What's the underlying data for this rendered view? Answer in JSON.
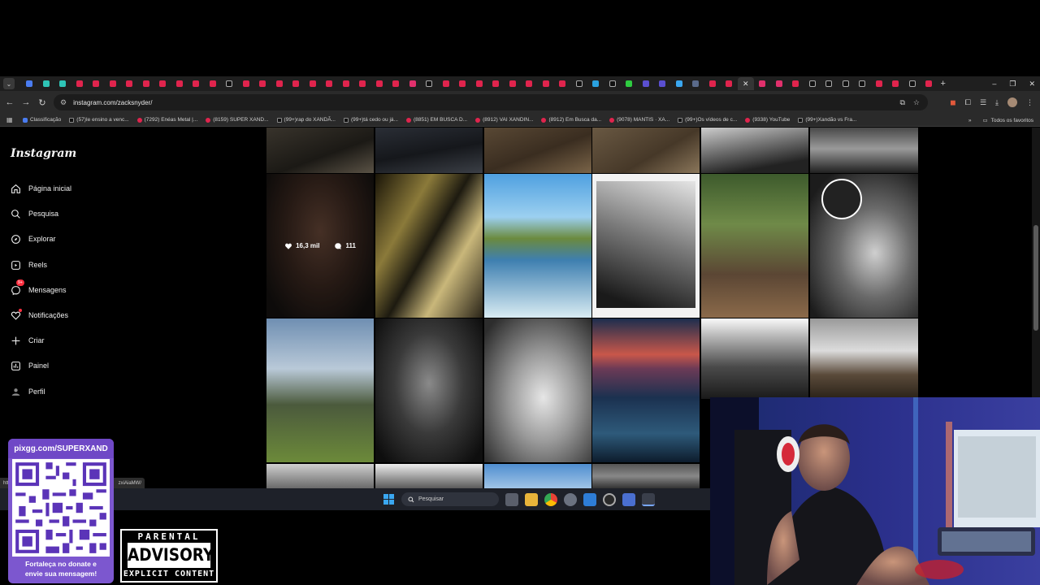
{
  "browser": {
    "tab_count": 55,
    "new_tab_label": "+",
    "window_controls": [
      "–",
      "❐",
      "✕"
    ],
    "address": {
      "url": "instagram.com/zacksnyder/"
    },
    "bookmarks": [
      {
        "label": "Classificação",
        "icon": "trophy-icon"
      },
      {
        "label": "(57)Ie ensino a venc...",
        "icon": "tiktok-icon"
      },
      {
        "label": "(7292) Enéas Metal |...",
        "icon": "youtube-icon"
      },
      {
        "label": "(8159) SUPER XAND...",
        "icon": "youtube-icon"
      },
      {
        "label": "(99+)rap do XANDÃ...",
        "icon": "tiktok-icon"
      },
      {
        "label": "(99+)tá cedo ou já...",
        "icon": "tiktok-icon"
      },
      {
        "label": "(8851) EM BUSCA D...",
        "icon": "youtube-icon"
      },
      {
        "label": "(8912) VAI XANDIN...",
        "icon": "youtube-icon"
      },
      {
        "label": "(8912) Em Busca da...",
        "icon": "youtube-icon"
      },
      {
        "label": "(9078) MANTIS · XA...",
        "icon": "youtube-icon"
      },
      {
        "label": "(99+)Os vídeos de c...",
        "icon": "tiktok-icon"
      },
      {
        "label": "(9338) YouTube",
        "icon": "youtube-icon"
      },
      {
        "label": "(99+)Xandão vs Fra...",
        "icon": "tiktok-icon"
      }
    ],
    "more_bookmarks": "»",
    "all_bookmarks": "Todos os favoritos",
    "status_url": {
      "left": "htt",
      "right": "zxiAiaMW/"
    }
  },
  "instagram": {
    "logo": "Instagram",
    "nav": [
      {
        "label": "Página inicial",
        "icon": "home-icon"
      },
      {
        "label": "Pesquisa",
        "icon": "search-icon"
      },
      {
        "label": "Explorar",
        "icon": "compass-icon"
      },
      {
        "label": "Reels",
        "icon": "reels-icon"
      },
      {
        "label": "Mensagens",
        "icon": "messenger-icon",
        "badge": "9+"
      },
      {
        "label": "Notificações",
        "icon": "heart-icon"
      },
      {
        "label": "Criar",
        "icon": "plus-icon"
      },
      {
        "label": "Painel",
        "icon": "dashboard-icon"
      },
      {
        "label": "Perfil",
        "icon": "avatar"
      }
    ],
    "hovered_post": {
      "likes": "16,3 mil",
      "comments": "111"
    }
  },
  "taskbar": {
    "search_placeholder": "Pesquisar"
  },
  "overlay": {
    "donate_url": "pixgg.com/SUPERXAND",
    "donate_text_1": "Fortaleça no donate e",
    "donate_text_2": "envie sua mensagem!",
    "advisory_top": "PARENTAL",
    "advisory_mid": "ADVISORY",
    "advisory_bottom": "EXPLICIT CONTENT"
  },
  "colors": {
    "youtube": "#e0244d",
    "instagram_badge": "#ff3040",
    "donate_purple": "#7c57cf",
    "taskbar": "#1e2129"
  }
}
